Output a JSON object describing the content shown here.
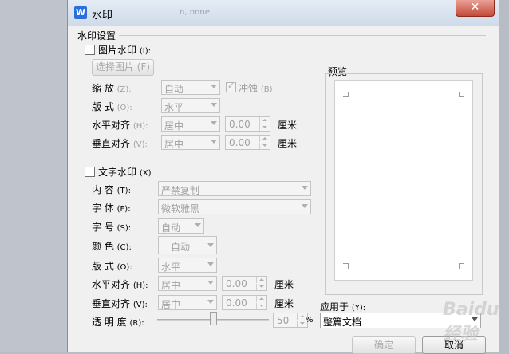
{
  "window": {
    "app_icon": "W",
    "title": "水印",
    "faded_text": "n, nnne",
    "close_glyph": "✕"
  },
  "group_label": "水印设置",
  "picture": {
    "checkbox_label": "图片水印",
    "hotkey": "(I):",
    "select_button": "选择图片 (F)",
    "scale": {
      "label": "缩    放",
      "hotkey": "(Z):",
      "value": "自动",
      "washout_label": "冲蚀",
      "washout_hotkey": "(B)"
    },
    "layout": {
      "label": "版    式",
      "hotkey": "(O):",
      "value": "水平"
    },
    "halign": {
      "label": "水平对齐",
      "hotkey": "(H):",
      "value": "居中",
      "offset": "0.00",
      "unit": "厘米"
    },
    "valign": {
      "label": "垂直对齐",
      "hotkey": "(V):",
      "value": "居中",
      "offset": "0.00",
      "unit": "厘米"
    }
  },
  "text": {
    "checkbox_label": "文字水印",
    "hotkey": "(X)",
    "content": {
      "label": "内    容",
      "hotkey": "(T):",
      "value": "严禁复制"
    },
    "font": {
      "label": "字    体",
      "hotkey": "(F):",
      "value": "微软雅黑"
    },
    "size": {
      "label": "字    号",
      "hotkey": "(S):",
      "value": "自动"
    },
    "color": {
      "label": "颜    色",
      "hotkey": "(C):",
      "value": "自动"
    },
    "layout": {
      "label": "版    式",
      "hotkey": "(O):",
      "value": "水平"
    },
    "halign": {
      "label": "水平对齐",
      "hotkey": "(H):",
      "value": "居中",
      "offset": "0.00",
      "unit": "厘米"
    },
    "valign": {
      "label": "垂直对齐",
      "hotkey": "(V):",
      "value": "居中",
      "offset": "0.00",
      "unit": "厘米"
    },
    "transparency": {
      "label": "透 明 度",
      "hotkey": "(R):",
      "value": "50",
      "unit": "%",
      "level_percent": 50
    }
  },
  "preview": {
    "label": "预览"
  },
  "apply": {
    "label": "应用于",
    "hotkey": "(Y):",
    "value": "整篇文档"
  },
  "buttons": {
    "ok": "确定",
    "cancel": "取消"
  },
  "watermark_overlay": "Baidu 经验"
}
